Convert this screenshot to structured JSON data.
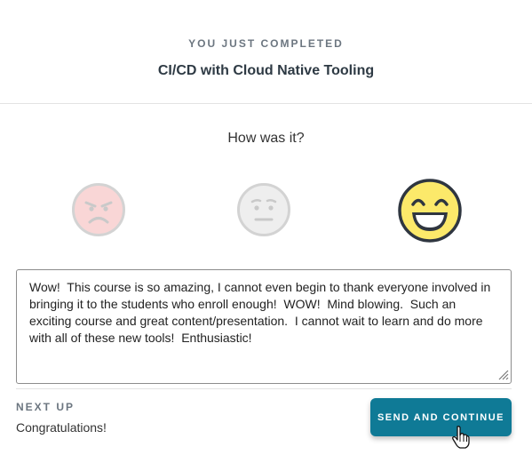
{
  "header": {
    "eyebrow": "YOU JUST COMPLETED",
    "course_title": "CI/CD with Cloud Native Tooling"
  },
  "rating": {
    "question": "How was it?",
    "options": [
      {
        "icon": "sad-face-icon",
        "selected": false,
        "color": "#f9d6d6"
      },
      {
        "icon": "neutral-face-icon",
        "selected": false,
        "color": "#eeeeee"
      },
      {
        "icon": "happy-face-icon",
        "selected": true,
        "color": "#fce96a"
      }
    ]
  },
  "comment": {
    "value": "Wow!  This course is so amazing, I cannot even begin to thank everyone involved in bringing it to the students who enroll enough!  WOW!  Mind blowing.  Such an exciting course and great content/presentation.  I cannot wait to learn and do more with all of these new tools!  Enthusiastic!"
  },
  "next_up": {
    "label": "NEXT UP",
    "value": "Congratulations!"
  },
  "actions": {
    "send_label": "SEND AND CONTINUE",
    "send_color": "#0f7a96"
  }
}
